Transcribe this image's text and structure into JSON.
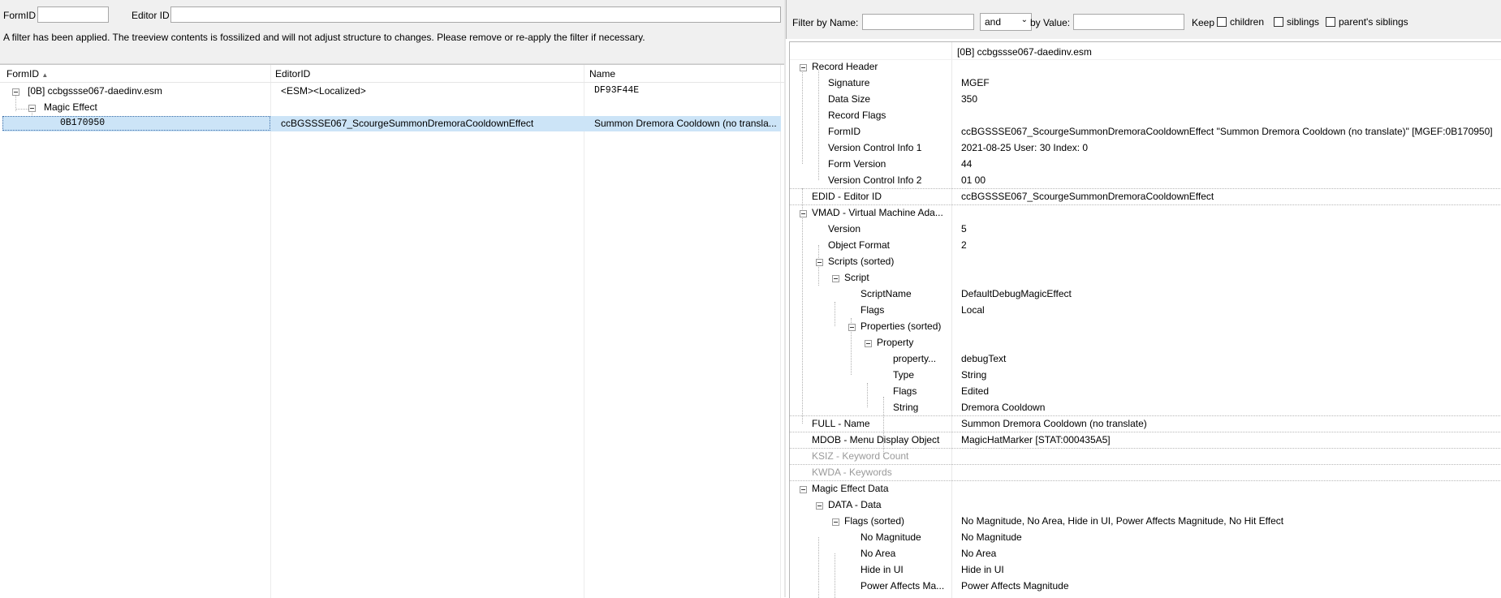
{
  "left": {
    "formid_label": "FormID",
    "editorid_label": "Editor ID",
    "formid_value": "",
    "editorid_value": "",
    "notice": "A filter has been applied. The treeview contents is fossilized and will not adjust structure to changes.  Please remove or re-apply the filter if necessary.",
    "columns": [
      "FormID",
      "EditorID",
      "Name"
    ],
    "sort_indicator": "▲",
    "rows": [
      {
        "formid": "[0B] ccbgssse067-daedinv.esm",
        "editorid": "<ESM><Localized>",
        "name": "DF93F44E"
      },
      {
        "formid": "Magic Effect",
        "editorid": "",
        "name": ""
      },
      {
        "formid": "0B170950",
        "editorid": "ccBGSSSE067_ScourgeSummonDremoraCooldownEffect",
        "name": "Summon Dremora Cooldown (no transla..."
      }
    ]
  },
  "right": {
    "filter_by_name_label": "Filter by Name:",
    "filter_name_value": "",
    "combo_value": "and",
    "by_value_label": "by Value:",
    "filter_value_value": "",
    "keep_label": "Keep",
    "keep_options": [
      "children",
      "siblings",
      "parent's siblings"
    ],
    "file_header": "[0B] ccbgssse067-daedinv.esm",
    "rows": [
      {
        "name": "Record Header",
        "value": ""
      },
      {
        "name": "Signature",
        "value": "MGEF"
      },
      {
        "name": "Data Size",
        "value": "350"
      },
      {
        "name": "Record Flags",
        "value": ""
      },
      {
        "name": "FormID",
        "value": "ccBGSSSE067_ScourgeSummonDremoraCooldownEffect \"Summon Dremora Cooldown (no translate)\" [MGEF:0B170950]"
      },
      {
        "name": "Version Control Info 1",
        "value": "2021-08-25 User: 30 Index: 0"
      },
      {
        "name": "Form Version",
        "value": "44"
      },
      {
        "name": "Version Control Info 2",
        "value": "01 00"
      },
      {
        "name": "EDID - Editor ID",
        "value": "ccBGSSSE067_ScourgeSummonDremoraCooldownEffect"
      },
      {
        "name": "VMAD - Virtual Machine Ada...",
        "value": ""
      },
      {
        "name": "Version",
        "value": "5"
      },
      {
        "name": "Object Format",
        "value": "2"
      },
      {
        "name": "Scripts (sorted)",
        "value": ""
      },
      {
        "name": "Script",
        "value": ""
      },
      {
        "name": "ScriptName",
        "value": "DefaultDebugMagicEffect"
      },
      {
        "name": "Flags",
        "value": "Local"
      },
      {
        "name": "Properties (sorted)",
        "value": ""
      },
      {
        "name": "Property",
        "value": ""
      },
      {
        "name": "property...",
        "value": "debugText"
      },
      {
        "name": "Type",
        "value": "String"
      },
      {
        "name": "Flags",
        "value": "Edited"
      },
      {
        "name": "String",
        "value": "Dremora Cooldown"
      },
      {
        "name": "FULL - Name",
        "value": "Summon Dremora Cooldown (no translate)"
      },
      {
        "name": "MDOB - Menu Display Object",
        "value": "MagicHatMarker [STAT:000435A5]"
      },
      {
        "name": "KSIZ - Keyword Count",
        "value": ""
      },
      {
        "name": "KWDA - Keywords",
        "value": ""
      },
      {
        "name": "Magic Effect Data",
        "value": ""
      },
      {
        "name": "DATA - Data",
        "value": ""
      },
      {
        "name": "Flags (sorted)",
        "value": "No Magnitude, No Area, Hide in UI, Power Affects Magnitude, No Hit Effect"
      },
      {
        "name": "No Magnitude",
        "value": "No Magnitude"
      },
      {
        "name": "No Area",
        "value": "No Area"
      },
      {
        "name": "Hide in UI",
        "value": "Hide in UI"
      },
      {
        "name": "Power Affects Ma...",
        "value": "Power Affects Magnitude"
      }
    ]
  }
}
